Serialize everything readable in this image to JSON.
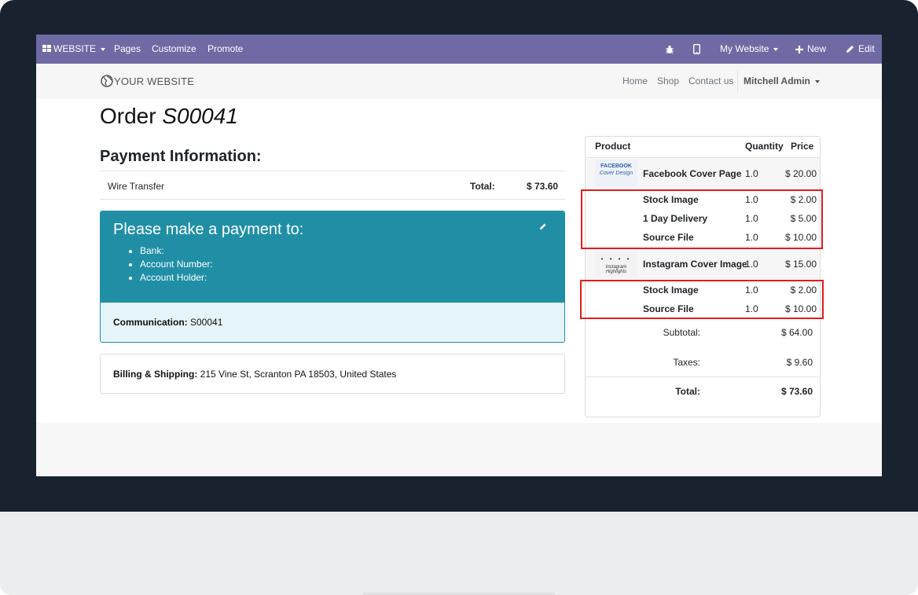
{
  "topbar": {
    "website_menu": "WEBSITE",
    "pages": "Pages",
    "customize": "Customize",
    "promote": "Promote",
    "my_website": "My Website",
    "new": "New",
    "edit": "Edit"
  },
  "navbar": {
    "brand": "YOUR WEBSITE",
    "links": [
      "Home",
      "Shop",
      "Contact us"
    ],
    "user": "Mitchell Admin"
  },
  "order": {
    "title_prefix": "Order",
    "reference": "S00041"
  },
  "payment": {
    "heading": "Payment Information:",
    "method": "Wire Transfer",
    "total_label": "Total:",
    "total_value": "$ 73.60",
    "box_title": "Please make a payment to:",
    "details": [
      "Bank:",
      "Account Number:",
      "Account Holder:"
    ],
    "communication_label": "Communication:",
    "communication_value": " S00041"
  },
  "billing": {
    "label": "Billing & Shipping:",
    "address": " 215 Vine St, Scranton PA 18503, United States"
  },
  "cart": {
    "headers": {
      "product": "Product",
      "quantity": "Quantity",
      "price": "Price"
    },
    "lines": [
      {
        "name": "Facebook Cover Page",
        "qty": "1.0",
        "price": "$ 20.00",
        "thumb_text": [
          "FACEBOOK",
          "Cover Design"
        ]
      },
      {
        "name": "Stock Image",
        "qty": "1.0",
        "price": "$ 2.00"
      },
      {
        "name": "1 Day Delivery",
        "qty": "1.0",
        "price": "$ 5.00"
      },
      {
        "name": "Source File",
        "qty": "1.0",
        "price": "$ 10.00"
      },
      {
        "name": "Instagram Cover Image",
        "qty": "1.0",
        "price": "$ 15.00",
        "thumb_text": [
          "Instagram Highlights"
        ]
      },
      {
        "name": "Stock Image",
        "qty": "1.0",
        "price": "$ 2.00"
      },
      {
        "name": "Source File",
        "qty": "1.0",
        "price": "$ 10.00"
      }
    ],
    "subtotal_label": "Subtotal:",
    "subtotal_value": "$ 64.00",
    "taxes_label": "Taxes:",
    "taxes_value": "$ 9.60",
    "total_label": "Total:",
    "total_value": "$ 73.60"
  },
  "colors": {
    "topbar": "#6f6aa3",
    "payment_box": "#208fa6",
    "payment_box_light": "#e4f4f8",
    "highlight": "#e11d1d",
    "bezel": "#18232f"
  }
}
